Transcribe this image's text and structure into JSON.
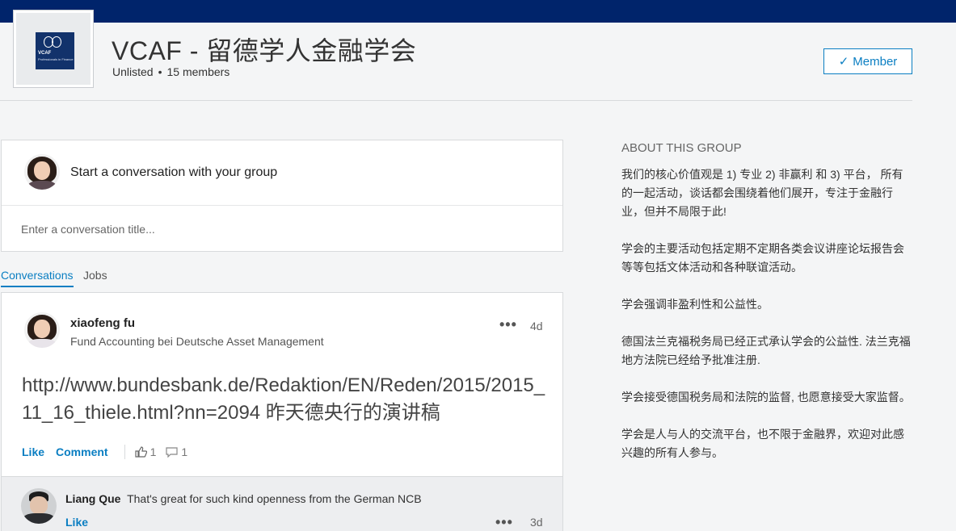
{
  "colors": {
    "topbar": "#00246b",
    "accent": "#0a7ec2"
  },
  "logo": {
    "text": "VCAF",
    "subtext": "Professionals in Finance"
  },
  "group": {
    "title": "VCAF - 留德学人金融学会",
    "visibility": "Unlisted",
    "members": "15 members",
    "member_button": "Member"
  },
  "composer": {
    "prompt": "Start a conversation with your group",
    "title_placeholder": "Enter a conversation title..."
  },
  "tabs": [
    {
      "label": "Conversations",
      "active": true
    },
    {
      "label": "Jobs",
      "active": false
    }
  ],
  "post": {
    "author": "xiaofeng fu",
    "headline": "Fund Accounting bei Deutsche Asset Management",
    "time": "4d",
    "body": "http://www.bundesbank.de/Redaktion/EN/Reden/2015/2015_11_16_thiele.html?nn=2094 昨天德央行的演讲稿",
    "like_label": "Like",
    "comment_label": "Comment",
    "like_count": "1",
    "comment_count": "1"
  },
  "comment": {
    "author": "Liang Que",
    "text": "That's great for such kind openness from the German NCB",
    "like_label": "Like",
    "time": "3d"
  },
  "about": {
    "heading": "ABOUT THIS GROUP",
    "paragraphs": [
      "我们的核心价值观是 1) 专业 2) 非赢利 和 3) 平台， 所有的一起活动，谈话都会围绕着他们展开，专注于金融行业，但并不局限于此!",
      "学会的主要活动包括定期不定期各类会议讲座论坛报告会等等包括文体活动和各种联谊活动。",
      "学会强调非盈利性和公益性。",
      "德国法兰克福税务局已经正式承认学会的公益性. 法兰克福地方法院已经给予批准注册.",
      "学会接受德国税务局和法院的监督, 也愿意接受大家监督。",
      "学会是人与人的交流平台，也不限于金融界，欢迎对此感兴趣的所有人参与。"
    ]
  }
}
